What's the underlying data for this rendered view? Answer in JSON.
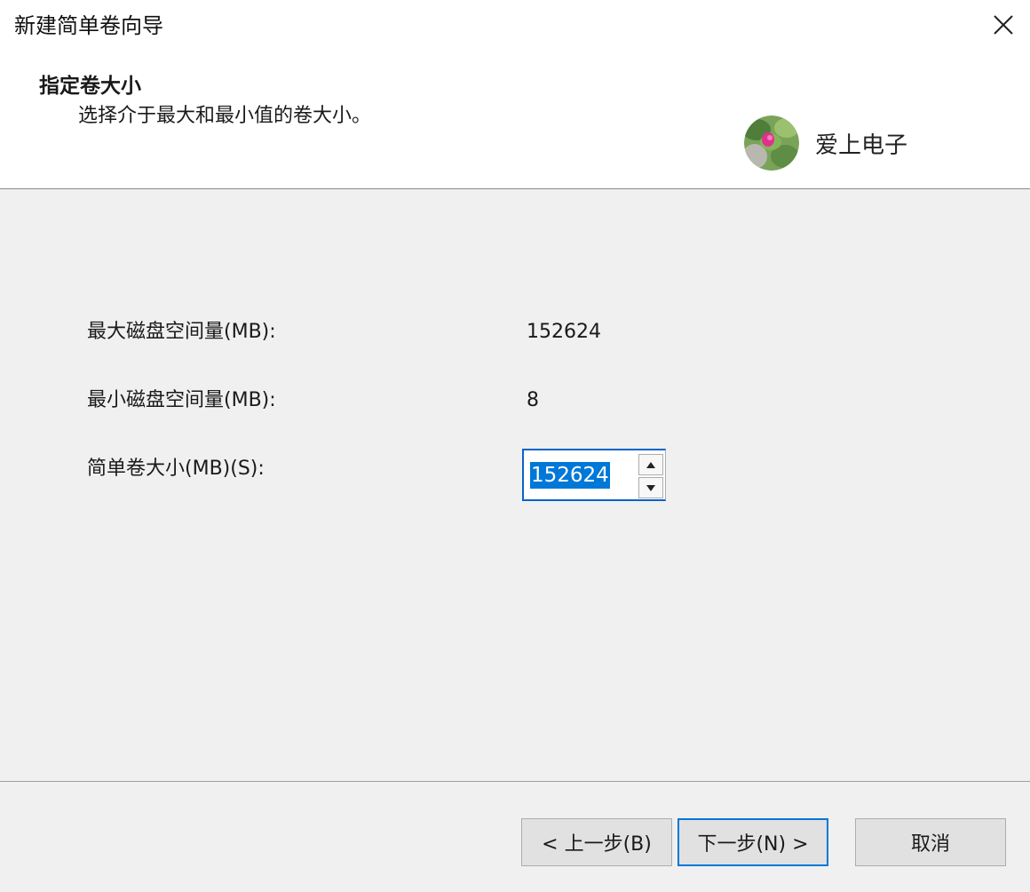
{
  "window": {
    "title": "新建简单卷向导",
    "close_icon": "close-icon"
  },
  "header": {
    "title": "指定卷大小",
    "description": "选择介于最大和最小值的卷大小。"
  },
  "watermark": {
    "text": "爱上电子",
    "avatar_icon": "flower-avatar"
  },
  "form": {
    "max_label": "最大磁盘空间量(MB):",
    "max_value": "152624",
    "min_label": "最小磁盘空间量(MB):",
    "min_value": "8",
    "size_label": "简单卷大小(MB)(S):",
    "size_value": "152624",
    "selection_color": "#0078d7"
  },
  "buttons": {
    "back": "< 上一步(B)",
    "next": "下一步(N) >",
    "cancel": "取消",
    "focus_color": "#0078d7"
  }
}
